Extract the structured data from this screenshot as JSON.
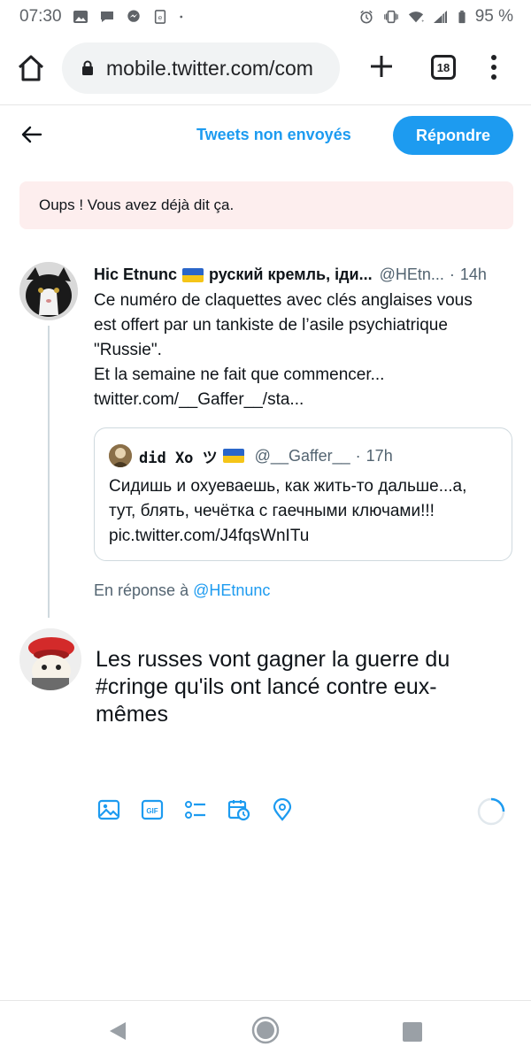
{
  "status_bar": {
    "time": "07:30",
    "battery": "95 %"
  },
  "browser": {
    "url": "mobile.twitter.com/com",
    "tab_count": "18"
  },
  "compose_header": {
    "drafts_label": "Tweets non envoyés",
    "reply_button_label": "Répondre"
  },
  "error": {
    "message": "Oups ! Vous avez déjà dit ça."
  },
  "original_tweet": {
    "author_name": "Hic Etnunc",
    "author_suffix": "руский кремль, іди...",
    "handle": "@HEtn...",
    "separator": "·",
    "time": "14h",
    "lines": [
      "Ce numéro de claquettes avec clés anglaises vous",
      "est offert par un tankiste de l’asile psychiatrique",
      "\"Russie\".",
      "Et la semaine ne fait que commencer...",
      "twitter.com/__Gaffer__/sta..."
    ]
  },
  "quoted_tweet": {
    "author_name": "did Xo ツ",
    "handle": "@__Gaffer__",
    "separator": "·",
    "time": "17h",
    "lines": [
      "Сидишь и охуеваешь, как жить-то дальше...а,",
      "тут, блять, чечётка с гаечными ключами!!!",
      "pic.twitter.com/J4fqsWnITu"
    ]
  },
  "reply_context": {
    "prefix": "En réponse à",
    "handle": "@HEtnunc"
  },
  "compose": {
    "lines": [
      "Les russes vont gagner la guerre du",
      "#cringe qu'ils ont lancé contre eux-",
      "mêmes"
    ]
  },
  "toolbar": {
    "icons": [
      "image-icon",
      "gif-icon",
      "poll-icon",
      "schedule-icon",
      "location-icon"
    ],
    "gif_label": "GIF"
  },
  "colors": {
    "accent": "#1d9bf0",
    "error_bg": "#fdeeee",
    "secondary_text": "#536471"
  }
}
